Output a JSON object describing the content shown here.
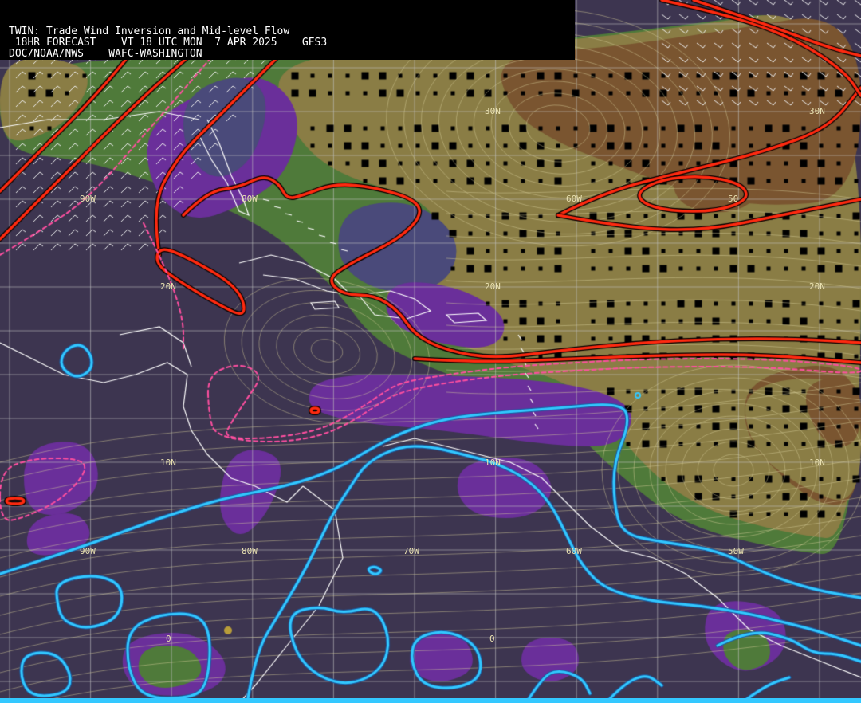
{
  "header": {
    "line1": "TWIN: Trade Wind Inversion and Mid-level Flow",
    "line2": " 18HR FORECAST    VT 18 UTC MON  7 APR 2025    GFS3",
    "line3": "DOC/NOAA/NWS    WAFC-WASHINGTON"
  },
  "labels": {
    "lat30w": "30N",
    "lat30e": "30N",
    "lat20w": "20N",
    "lat20c": "20N",
    "lat20e": "20N",
    "lat10w": "10N",
    "lat10c": "10N",
    "lat10e": "10N",
    "lon90n": "90W",
    "lon80n": "80W",
    "lon60n": "60W",
    "lon50n": "50",
    "lon90s": "90W",
    "lon80s": "80W",
    "lon70s": "70W",
    "lon60s": "60W",
    "lon50s": "50W",
    "eq1": "0",
    "eq2": "0"
  },
  "colors": {
    "background": "#3d3550",
    "purple": "#6a2f9a",
    "blue_gray": "#4a4a7a",
    "green": "#4f7a3a",
    "olive": "#8a7d45",
    "brown": "#7a5530",
    "inversion_contour": "#ff2a10",
    "dashed_contour": "#ff4fa0",
    "moist_contour": "#33c8ff",
    "streamline": "#d8cf9a",
    "coastline": "#ffffff",
    "grid": "#bfbfbf"
  }
}
